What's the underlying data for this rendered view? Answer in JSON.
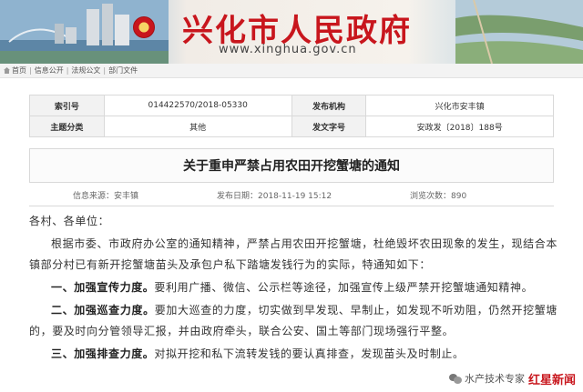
{
  "header": {
    "site_title": "兴化市人民政府",
    "domain": "www.xinghua.gov.cn"
  },
  "breadcrumb": [
    "首页",
    "信息公开",
    "法规公文",
    "部门文件"
  ],
  "meta": {
    "rows": [
      {
        "l1": "索引号",
        "v1": "014422570/2018-05330",
        "l2": "发布机构",
        "v2": "兴化市安丰镇"
      },
      {
        "l1": "主题分类",
        "v1": "其他",
        "l2": "发文字号",
        "v2": "安政发〔2018〕188号"
      }
    ]
  },
  "notice": {
    "title": "关于重申严禁占用农田开挖蟹塘的通知",
    "source_label": "信息来源：安丰镇",
    "date_label": "发布日期：2018-11-19 15:12",
    "views_label": "浏览次数：890"
  },
  "body": {
    "greeting": "各村、各单位：",
    "intro": "根据市委、市政府办公室的通知精神，严禁占用农田开挖蟹塘，杜绝毁坏农田现象的发生，现结合本镇部分村已有新开挖蟹塘苗头及承包户私下踏塘发钱行为的实际，特通知如下：",
    "items": [
      {
        "head": "一、加强宣传力度。",
        "text": "要利用广播、微信、公示栏等途径，加强宣传上级严禁开挖蟹塘通知精神。"
      },
      {
        "head": "二、加强巡查力度。",
        "text": "要加大巡查的力度，切实做到早发现、早制止，如发现不听劝阻，仍然开挖蟹塘的，要及时向分管领导汇报，并由政府牵头，联合公安、国土等部门现场强行平整。"
      },
      {
        "head": "三、加强排查力度。",
        "text": "对拟开挖和私下流转发钱的要认真排查，发现苗头及时制止。"
      }
    ]
  },
  "watermark": {
    "account": "水产技术专家",
    "seal": "红星新闻"
  },
  "colors": {
    "brand_red": "#c8161d",
    "label_bg": "#f2f2f2",
    "border": "#d9d9d9"
  }
}
